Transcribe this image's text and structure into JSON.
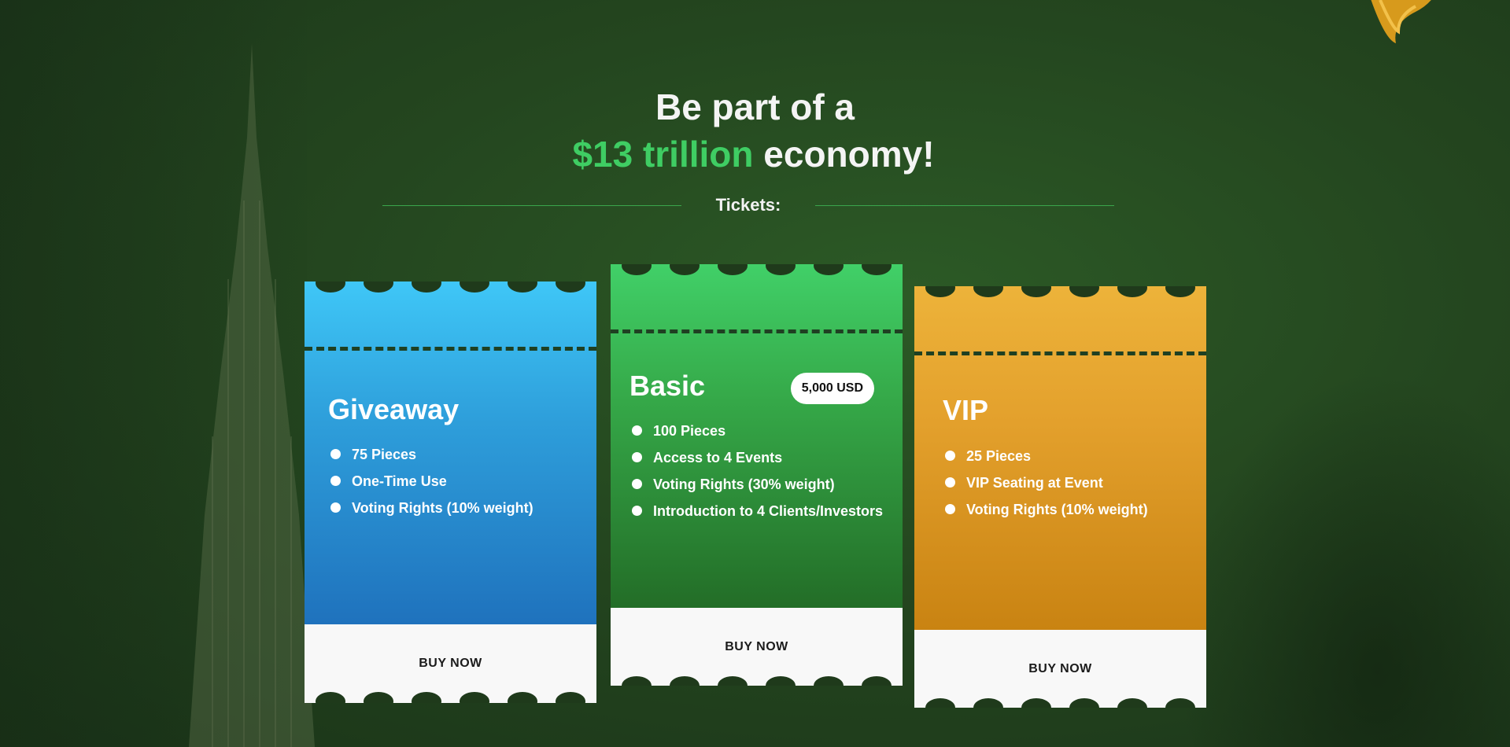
{
  "headline": {
    "line1": "Be part of a",
    "accent": "$13 trillion",
    "line2_rest": " economy!"
  },
  "section_label": "Tickets:",
  "colors": {
    "accent_green": "#3fcd63",
    "giveaway_blue": "#2e9fdb",
    "basic_green": "#35a848",
    "vip_gold": "#e3a02c"
  },
  "tickets": [
    {
      "name": "Giveaway",
      "features": [
        "75 Pieces",
        "One-Time Use",
        "Voting Rights (10% weight)"
      ],
      "button": "BUY NOW"
    },
    {
      "name": "Basic",
      "price": "5,000 USD",
      "features": [
        "100 Pieces",
        "Access to 4 Events",
        "Voting Rights (30% weight)",
        "Introduction to 4 Clients/Investors"
      ],
      "button": "BUY NOW"
    },
    {
      "name": "VIP",
      "features": [
        "25 Pieces",
        "VIP Seating at Event",
        "Voting Rights (10% weight)"
      ],
      "button": "BUY NOW"
    }
  ]
}
